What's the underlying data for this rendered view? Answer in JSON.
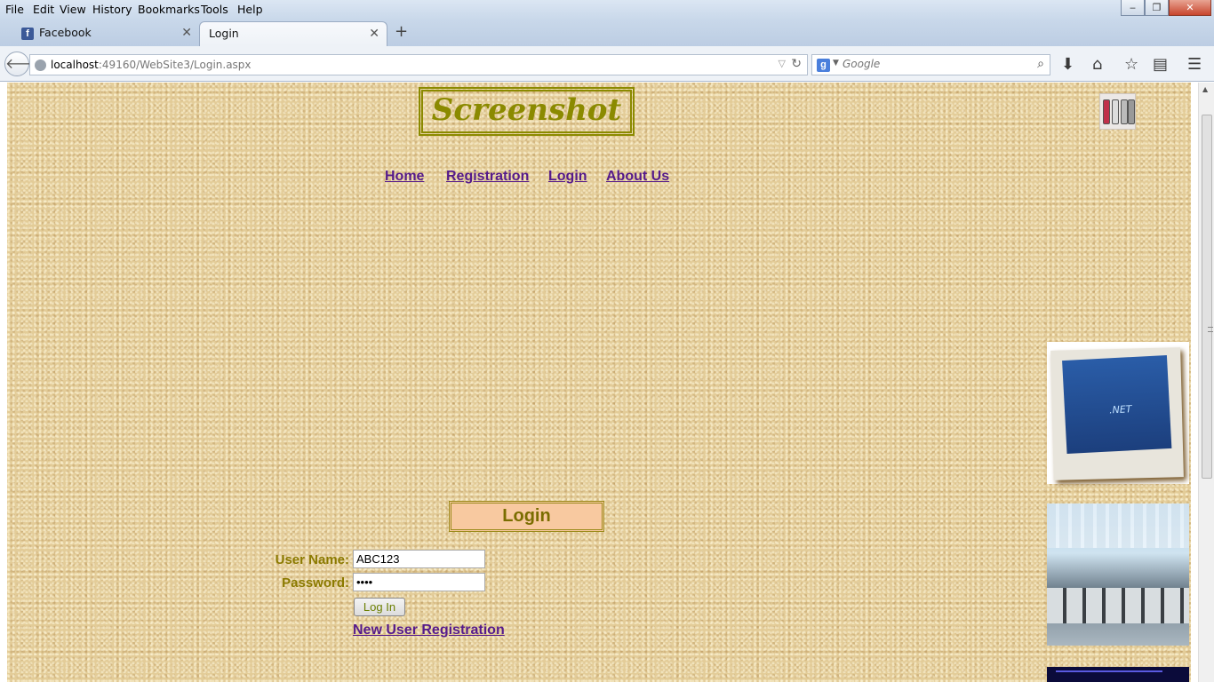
{
  "browser": {
    "menu": [
      "File",
      "Edit",
      "View",
      "History",
      "Bookmarks",
      "Tools",
      "Help"
    ],
    "tabs": [
      {
        "label": "Facebook",
        "icon": "facebook-icon",
        "active": false
      },
      {
        "label": "Login",
        "icon": "",
        "active": true
      }
    ],
    "url": {
      "host": "localhost",
      "rest": ":49160/WebSite3/Login.aspx"
    },
    "search_placeholder": "Google",
    "window_controls": {
      "minimize": "‒",
      "restore": "❐",
      "close": "✕"
    }
  },
  "site": {
    "title": "Screenshot",
    "nav": [
      "Home",
      "Registration",
      "Login",
      "About Us"
    ]
  },
  "login": {
    "heading": "Login",
    "username_label": "User Name:",
    "username_value": "ABC123",
    "password_label": "Password:",
    "password_value": "••••",
    "button_label": "Log In",
    "register_link": "New User Registration"
  },
  "side_images": [
    ".NET",
    "office",
    "dark"
  ],
  "colors": {
    "accent_olive": "#8b7a00",
    "link": "#551a8b",
    "login_bg": "#f8c9a0"
  }
}
